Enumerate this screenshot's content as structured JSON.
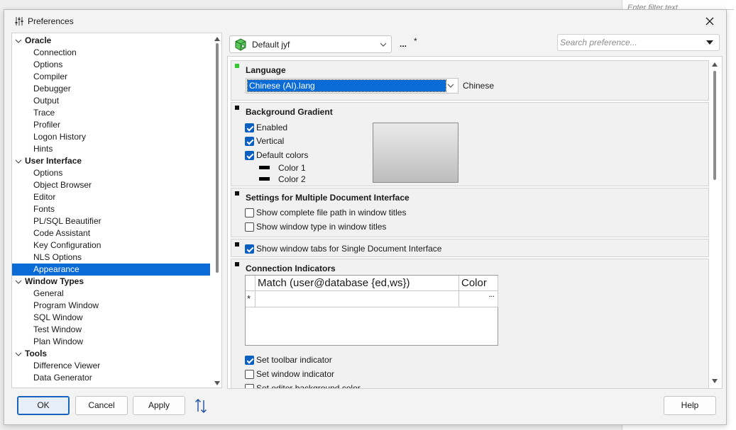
{
  "background": {
    "filter_placeholder": "Enter filter text"
  },
  "dialog": {
    "title": "Preferences",
    "title_icon": "sliders-icon",
    "close_icon": "close-icon"
  },
  "tree": {
    "categories": [
      {
        "label": "Oracle",
        "items": [
          "Connection",
          "Options",
          "Compiler",
          "Debugger",
          "Output",
          "Trace",
          "Profiler",
          "Logon History",
          "Hints"
        ]
      },
      {
        "label": "User Interface",
        "items": [
          "Options",
          "Object Browser",
          "Editor",
          "Fonts",
          "PL/SQL Beautifier",
          "Code Assistant",
          "Key Configuration",
          "NLS Options",
          "Appearance"
        ]
      },
      {
        "label": "Window Types",
        "items": [
          "General",
          "Program Window",
          "SQL Window",
          "Test Window",
          "Plan Window"
        ]
      },
      {
        "label": "Tools",
        "items": [
          "Difference Viewer",
          "Data Generator"
        ]
      }
    ],
    "selected": "Appearance"
  },
  "toolbar": {
    "profile": "Default jyf",
    "profile_icon": "cube-icon",
    "dots_label": "...",
    "modified_mark": "*",
    "search_placeholder": "Search preference..."
  },
  "sections": {
    "language": {
      "title": "Language",
      "value": "Chinese (AI).lang",
      "description": "Chinese"
    },
    "background_gradient": {
      "title": "Background Gradient",
      "checks": [
        {
          "label": "Enabled",
          "checked": true
        },
        {
          "label": "Vertical",
          "checked": true
        },
        {
          "label": "Default colors",
          "checked": true
        }
      ],
      "colors": [
        "Color 1",
        "Color 2"
      ],
      "swatch_color": "#000000"
    },
    "mdi": {
      "title": "Settings for Multiple Document Interface",
      "checks": [
        {
          "label": "Show complete file path in window titles",
          "checked": false
        },
        {
          "label": "Show window type in window titles",
          "checked": false
        }
      ]
    },
    "sdi": {
      "check": {
        "label": "Show window tabs for Single Document Interface",
        "checked": true
      }
    },
    "connection_indicators": {
      "title": "Connection Indicators",
      "columns": [
        "Match (user@database {ed,ws})",
        "Color"
      ],
      "new_row_marker": "*",
      "ellipsis": "···",
      "checks": [
        {
          "label": "Set toolbar indicator",
          "checked": true
        },
        {
          "label": "Set window indicator",
          "checked": false
        },
        {
          "label": "Set editor background color",
          "checked": false
        }
      ]
    }
  },
  "buttons": {
    "ok": "OK",
    "cancel": "Cancel",
    "apply": "Apply",
    "help": "Help",
    "sort_icon": "sort-arrows-icon"
  },
  "colors": {
    "accent": "#0a6ad6",
    "checkbox": "#0a5fc2",
    "marker_active": "#2ecc2e"
  }
}
